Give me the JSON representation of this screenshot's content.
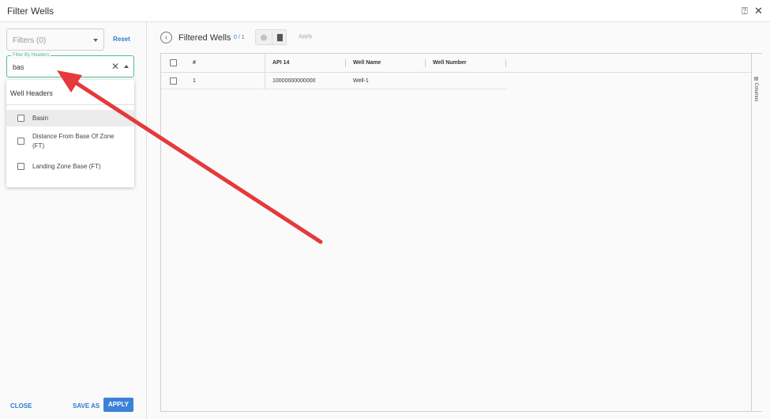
{
  "window": {
    "title": "Filter Wells"
  },
  "left_panel": {
    "filters_select": {
      "value": "Filters (0)"
    },
    "reset_label": "Reset",
    "filter_input": {
      "legend": "Filter By Headers",
      "value": "bas"
    },
    "dropdown": {
      "group": "Well Headers",
      "options": [
        {
          "label": "Basin",
          "highlighted": true
        },
        {
          "label": "Distance From Base Of Zone (FT)",
          "highlighted": false
        },
        {
          "label": "Landing Zone Base (FT)",
          "highlighted": false
        }
      ]
    },
    "footer": {
      "close_label": "CLOSE",
      "save_as_label": "SAVE AS",
      "apply_label": "APPLY"
    }
  },
  "right_panel": {
    "title": "Filtered Wells",
    "count": "0 / 1",
    "apply_label": "Apply",
    "grid": {
      "columns": [
        "#",
        "API 14",
        "Well Name",
        "Well Number"
      ],
      "rows": [
        {
          "index": "1",
          "api14": "10000000000000",
          "well_name": "Well-1",
          "well_number": ""
        }
      ]
    },
    "side_panel_label": "Columns"
  },
  "colors": {
    "accent": "#3b82d6",
    "focus": "#4fbf8a",
    "annotation_arrow": "#e5393c"
  }
}
